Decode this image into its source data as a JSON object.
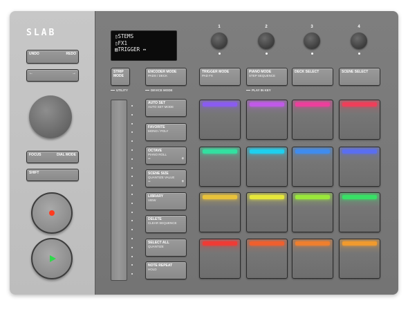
{
  "brand": {
    "logo": "SLAB"
  },
  "display": {
    "lines": [
      "▯STEMS",
      "▯FX1",
      "▤TRIGGER ↔"
    ]
  },
  "left": {
    "undo": "UNDO",
    "redo": "REDO",
    "arrow_left": "←",
    "arrow_right": "→",
    "focus": "FOCUS",
    "dial_mode": "DIAL MODE",
    "shift": "SHIFT"
  },
  "knobs": [
    "1",
    "2",
    "3",
    "4"
  ],
  "top_buttons": [
    {
      "label": "STRIP MODE",
      "sub": ""
    },
    {
      "label": "ENCODER MODE",
      "sub": "PADS / DECK"
    },
    {
      "label": "TRIGGER MODE",
      "sub": "PAD FX"
    },
    {
      "label": "PIANO MODE",
      "sub": "STEP SEQUENCE"
    },
    {
      "label": "DECK SELECT",
      "sub": ""
    },
    {
      "label": "SCENE SELECT",
      "sub": ""
    }
  ],
  "group_labels": {
    "utility": "UTILITY",
    "device_mode": "DEVICE MODE",
    "play_in_key": "PLAY IN KEY"
  },
  "side_buttons": [
    {
      "label": "AUTO SET",
      "sub": "AUTO SET MODE",
      "minus": "",
      "plus": ""
    },
    {
      "label": "FAVORITE",
      "sub": "MONO / POLY",
      "minus": "",
      "plus": ""
    },
    {
      "label": "OCTAVE",
      "sub": "PIANO ROLL",
      "minus": "−",
      "plus": "+"
    },
    {
      "label": "SCENE SIZE",
      "sub": "QUANTIZE VALUE",
      "minus": "−",
      "plus": "+"
    },
    {
      "label": "LIBRARY",
      "sub": "VIEW",
      "minus": "",
      "plus": ""
    },
    {
      "label": "DELETE",
      "sub": "CLEAR SEQUENCE",
      "minus": "",
      "plus": ""
    },
    {
      "label": "SELECT ALL",
      "sub": "QUANTIZE",
      "minus": "",
      "plus": ""
    },
    {
      "label": "NOTE REPEAT",
      "sub": "HOLD",
      "minus": "",
      "plus": ""
    }
  ],
  "pads": {
    "rows": [
      [
        "#8a5cf0",
        "#c05ae8",
        "#ec3f9c",
        "#ee3f5a"
      ],
      [
        "#33e0a0",
        "#1ed0ef",
        "#3f8cef",
        "#5a6ef0"
      ],
      [
        "#e8c23a",
        "#e6e83a",
        "#9ae83a",
        "#38e065"
      ],
      [
        "#ef3b35",
        "#ef5f2e",
        "#ef7f2e",
        "#f09a2e"
      ]
    ]
  },
  "colors": {
    "record_button": "#ff3b1f",
    "play_button": "#2fd84a",
    "left_panel": "#c2c2c2",
    "right_panel": "#7a7a7a"
  },
  "icons": {
    "record": "record-dot-icon",
    "play": "play-triangle-icon"
  }
}
